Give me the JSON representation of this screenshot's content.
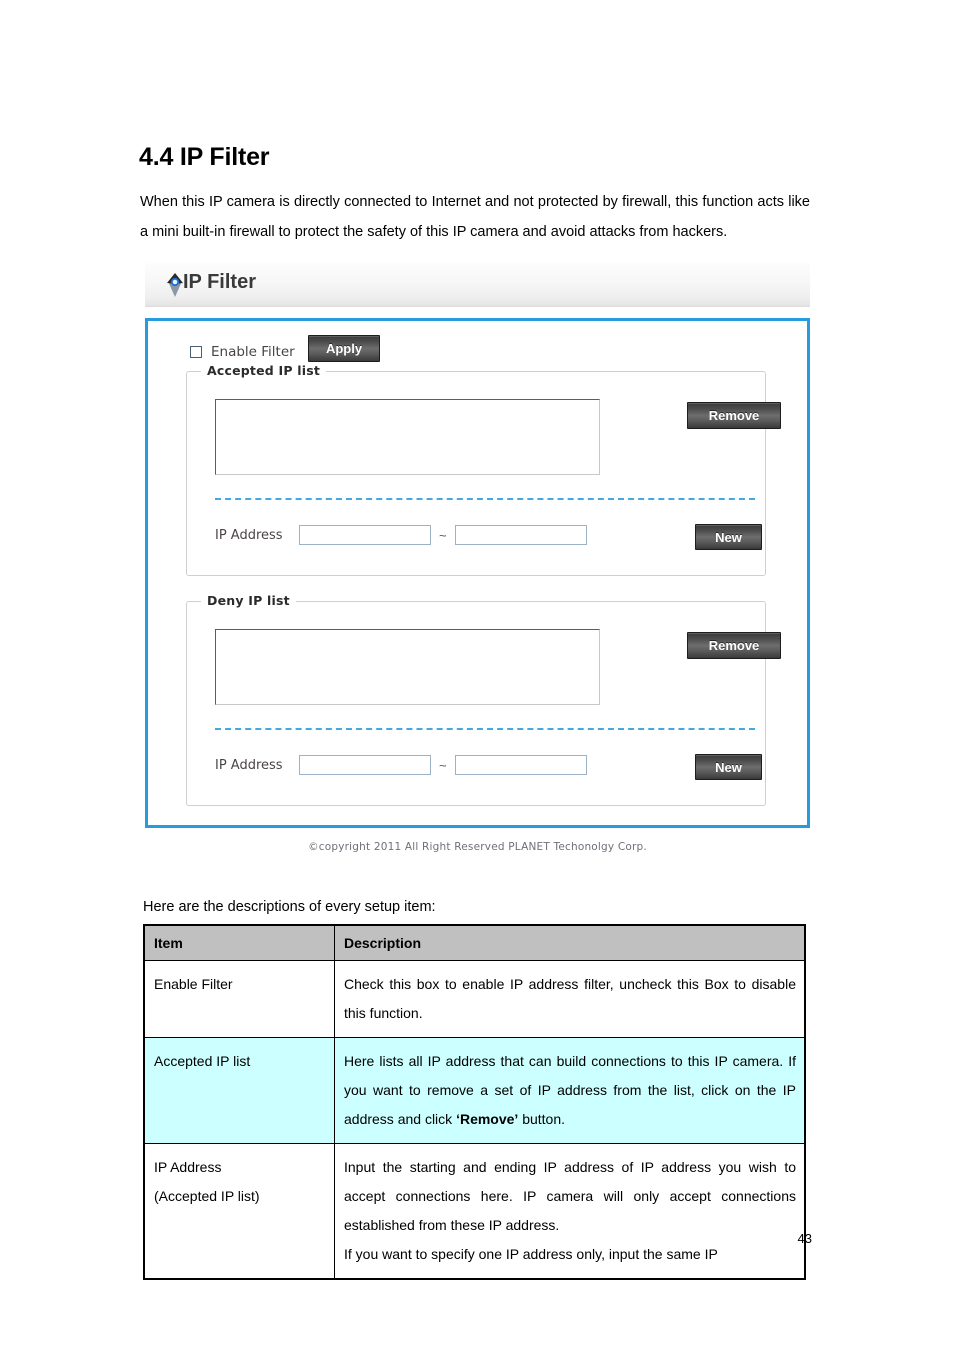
{
  "document": {
    "section_number_title": "4.4 IP Filter",
    "intro_paragraph": "When this IP camera is directly connected to Internet and not protected by firewall, this function acts like a mini built-in firewall to protect the safety of this IP camera and avoid attacks from hackers.",
    "lead_in": "Here are the descriptions of every setup item:",
    "page_number": "43"
  },
  "screenshot": {
    "header": {
      "title": "IP Filter",
      "icon": "planet-diamond-logo-icon"
    },
    "enable_filter": {
      "label": "Enable Filter",
      "checked": false
    },
    "apply_button": "Apply",
    "accepted": {
      "legend": "Accepted IP list",
      "list_items": [],
      "ip_address_label": "IP Address",
      "range_separator": "~",
      "start_value": "",
      "end_value": "",
      "remove_button": "Remove",
      "new_button": "New"
    },
    "deny": {
      "legend": "Deny IP list",
      "list_items": [],
      "ip_address_label": "IP Address",
      "range_separator": "~",
      "start_value": "",
      "end_value": "",
      "remove_button": "Remove",
      "new_button": "New"
    },
    "copyright": "©copyright 2011 All Right Reserved PLANET Techonolgy Corp.",
    "colors": {
      "panel_border": "#269cdc",
      "dashed_separator": "#45a8e0",
      "button_face": "#6d6d6d"
    }
  },
  "table": {
    "headers": {
      "item": "Item",
      "description": "Description"
    },
    "rows": [
      {
        "item": "Enable Filter",
        "description_html": "Check this box to enable IP address filter, uncheck this Box to disable this function.",
        "highlighted": false
      },
      {
        "item": "Accepted IP list",
        "description_html": "Here lists all IP address that can build connections to this IP camera. If you want to remove a set of IP address from the list, click on the IP address and click <b>&lsquo;Remove&rsquo;</b> button.",
        "highlighted": true
      },
      {
        "item": "IP Address\n(Accepted IP list)",
        "description_html": "Input the starting and ending IP address of IP address you wish to accept connections here. IP camera will only accept connections established from these IP address.<br>If you want to specify one IP address only, input the same IP",
        "highlighted": false
      }
    ]
  }
}
